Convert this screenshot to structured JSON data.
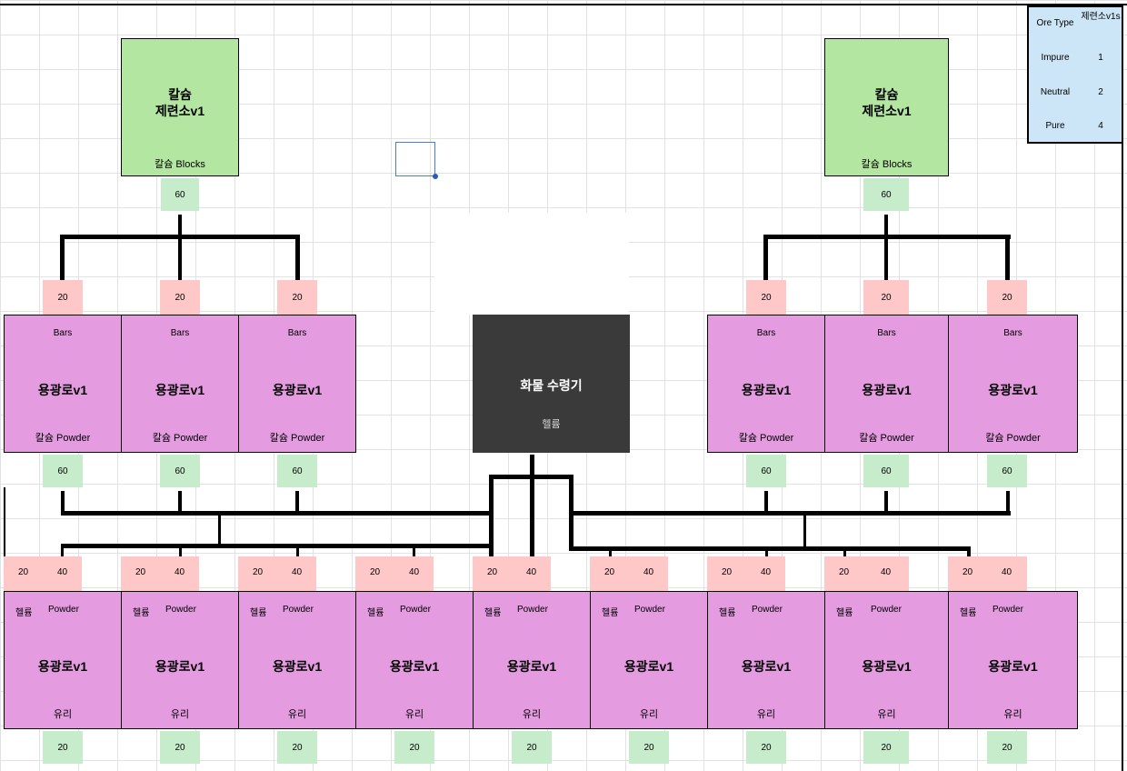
{
  "legend": {
    "col1_header": "Ore Type",
    "col2_header": "제련소v1s",
    "rows": [
      {
        "type": "Impure",
        "count": "1"
      },
      {
        "type": "Neutral",
        "count": "2"
      },
      {
        "type": "Pure",
        "count": "4"
      }
    ]
  },
  "refineries": [
    {
      "title": "칼슘\n제련소v1",
      "output": "칼슘 Blocks",
      "rate": "60"
    },
    {
      "title": "칼슘\n제련소v1",
      "output": "칼슘 Blocks",
      "rate": "60"
    }
  ],
  "upper_smelters": {
    "input_rate": "20",
    "top_label": "Bars",
    "title": "용광로v1",
    "bottom_label": "칼슘 Powder",
    "output_rate": "60"
  },
  "receiver": {
    "title": "화물 수령기",
    "subtitle": "헬륨"
  },
  "lower_smelters": {
    "input_rate_a": "20",
    "input_rate_b": "40",
    "input_a": "헬륨",
    "input_b": "Powder",
    "title": "용광로v1",
    "output": "유리",
    "output_rate": "20"
  }
}
